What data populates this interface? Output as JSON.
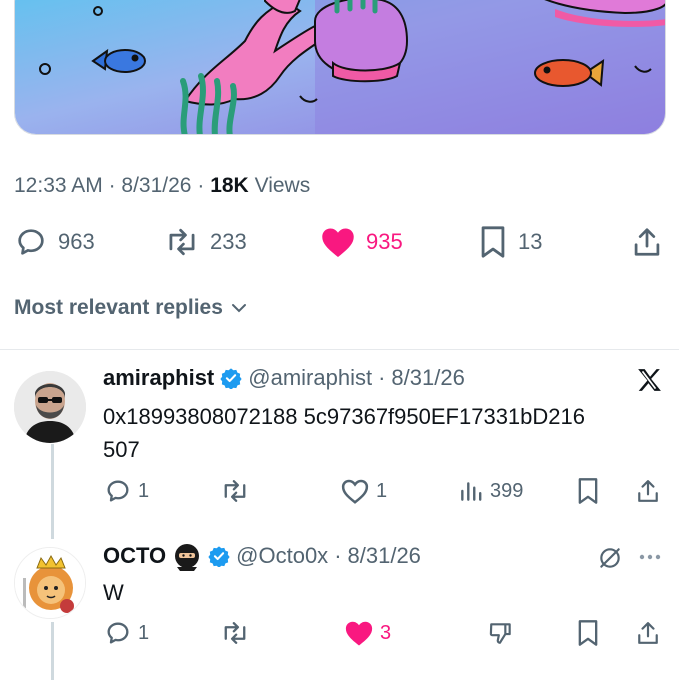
{
  "post": {
    "time": "12:33 AM",
    "dot": "·",
    "date": "8/31/26",
    "views_count": "18K",
    "views_label": "Views",
    "replies": "963",
    "reposts": "233",
    "likes": "935",
    "bookmarks": "13"
  },
  "sort_label": "Most relevant replies",
  "colors": {
    "like": "#f91880",
    "verified": "#1d9bf0",
    "secondary": "#536471"
  },
  "replies": [
    {
      "name": "amiraphist",
      "handle": "@amiraphist",
      "dot": "·",
      "date": "8/31/26",
      "text_line1": "0x18993808072188 5c97367f950EF17331bD216",
      "text_line2": "507",
      "replies": "1",
      "likes": "1",
      "views": "399",
      "badge_icon": "x-logo-icon"
    },
    {
      "name": "OCTO",
      "handle": "@Octo0x",
      "dot": "·",
      "date": "8/31/26",
      "text": "W",
      "replies": "1",
      "likes": "3"
    }
  ]
}
